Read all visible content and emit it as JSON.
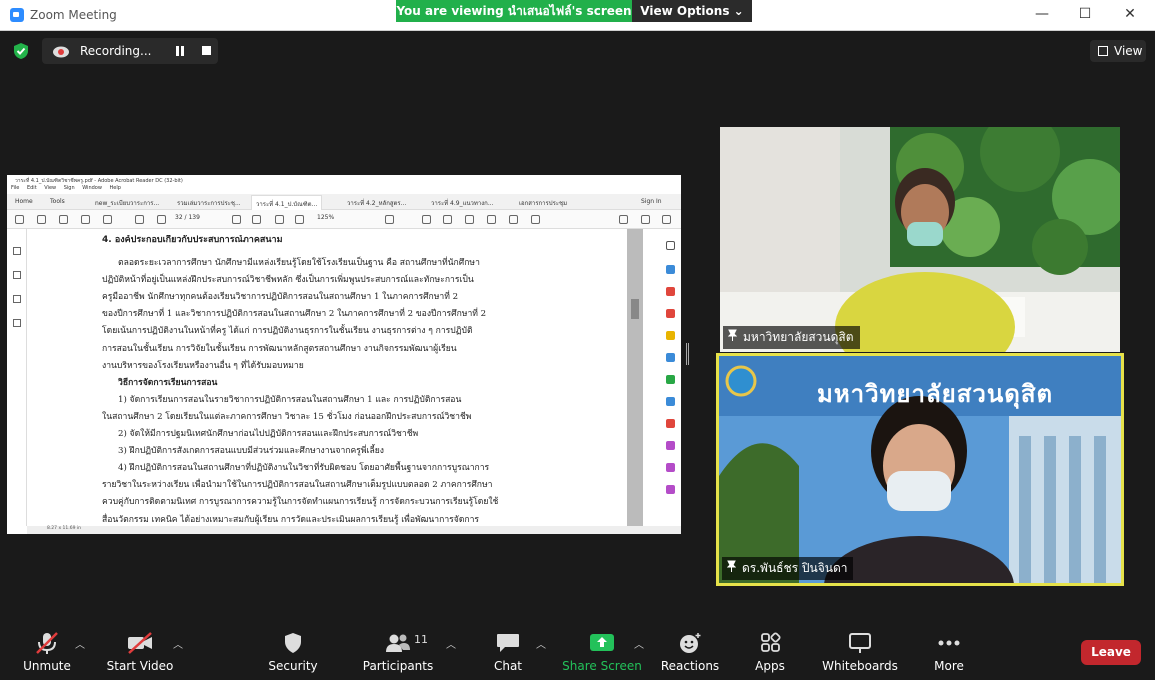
{
  "window": {
    "title": "Zoom Meeting"
  },
  "banner": {
    "text": "You are viewing นำเสนอไฟล์'s screen",
    "view_options": "View Options ⌄"
  },
  "recording": {
    "label": "Recording..."
  },
  "view_button": {
    "label": "View"
  },
  "shared_screen": {
    "app_title": "วาระที่ 4.1_ป.บัณฑิตวิชาชีพครู.pdf - Adobe Acrobat Reader DC (32-bit)",
    "menu": [
      "File",
      "Edit",
      "View",
      "Sign",
      "Window",
      "Help"
    ],
    "tabs": [
      "Home",
      "Tools",
      "new_ระเบียบวาระการ...",
      "รวมเล่มวาระการประชุ...",
      "วาระที่ 4.1_ป.บัณฑิต...",
      "วาระที่ 4.2_หลักสูตร...",
      "วาระที่ 4.9_แนวทางก...",
      "เอกสารการประชุม"
    ],
    "sign_in": "Sign In",
    "page_indicator": "32 / 139",
    "zoom": "125%",
    "doc_heading": "4. องค์ประกอบเกี่ยวกับประสบการณ์ภาคสนาม",
    "doc_lines": [
      "ตลอดระยะเวลาการศึกษา นักศึกษามีแหล่งเรียนรู้โดยใช้โรงเรียนเป็นฐาน คือ สถานศึกษาที่นักศึกษา",
      "ปฏิบัติหน้าที่อยู่เป็นแหล่งฝึกประสบการณ์วิชาชีพหลัก ซึ่งเป็นการเพิ่มพูนประสบการณ์และทักษะการเป็น",
      "ครูมืออาชีพ นักศึกษาทุกคนต้องเรียนวิชาการปฏิบัติการสอนในสถานศึกษา 1 ในภาคการศึกษาที่ 2",
      "ของปีการศึกษาที่ 1 และวิชาการปฏิบัติการสอนในสถานศึกษา 2 ในภาคการศึกษาที่ 2 ของปีการศึกษาที่ 2",
      "โดยเน้นการปฏิบัติงานในหน้าที่ครู ได้แก่ การปฏิบัติงานธุรการในชั้นเรียน งานธุรการต่าง ๆ การปฏิบัติ",
      "การสอนในชั้นเรียน การวิจัยในชั้นเรียน การพัฒนาหลักสูตรสถานศึกษา งานกิจกรรมพัฒนาผู้เรียน",
      "งานบริหารของโรงเรียนหรืองานอื่น ๆ ที่ได้รับมอบหมาย"
    ],
    "doc_subheading": "วิธีการจัดการเรียนการสอน",
    "doc_lines2": [
      "1) จัดการเรียนการสอนในรายวิชาการปฏิบัติการสอนในสถานศึกษา 1 และ การปฏิบัติการสอน",
      "ในสถานศึกษา 2 โดยเรียนในแต่ละภาคการศึกษา วิชาละ 15 ชั่วโมง ก่อนออกฝึกประสบการณ์วิชาชีพ",
      "2) จัดให้มีการปฐมนิเทศนักศึกษาก่อนไปปฏิบัติการสอนและฝึกประสบการณ์วิชาชีพ",
      "3) ฝึกปฏิบัติการสังเกตการสอนแบบมีส่วนร่วมและศึกษางานจากครูพี่เลี้ยง",
      "4) ฝึกปฏิบัติการสอนในสถานศึกษาที่ปฏิบัติงานในวิชาที่รับผิดชอบ โดยอาศัยพื้นฐานจากการบูรณาการ",
      "รายวิชาในระหว่างเรียน เพื่อนำมาใช้ในการปฏิบัติการสอนในสถานศึกษาเต็มรูปแบบตลอด 2 ภาคการศึกษา",
      "ควบคู่กับการติดตามนิเทศ การบูรณาการความรู้ในการจัดทำแผนการเรียนรู้ การจัดกระบวนการเรียนรู้โดยใช้",
      "สื่อนวัตกรรม เทคนิค ได้อย่างเหมาะสมกับผู้เรียน การวัดและประเมินผลการเรียนรู้ เพื่อพัฒนาการจัดการ"
    ],
    "status": "8.27 x 11.69 in"
  },
  "participants_video": [
    {
      "name": "มหาวิทยาลัยสวนดุสิต"
    },
    {
      "name": "ดร.พันธ์ชร ปินจินดา",
      "backdrop_text": "มหาวิทยาลัยสวนดุสิต"
    }
  ],
  "toolbar": {
    "unmute": "Unmute",
    "start_video": "Start Video",
    "security": "Security",
    "participants": "Participants",
    "participants_count": "11",
    "chat": "Chat",
    "share_screen": "Share Screen",
    "reactions": "Reactions",
    "apps": "Apps",
    "whiteboards": "Whiteboards",
    "more": "More",
    "leave": "Leave"
  },
  "colors": {
    "share_green": "#21b04b",
    "leave_red": "#c2272d",
    "active_speaker": "#e6e24a",
    "zoom_blue": "#2d8cff"
  }
}
